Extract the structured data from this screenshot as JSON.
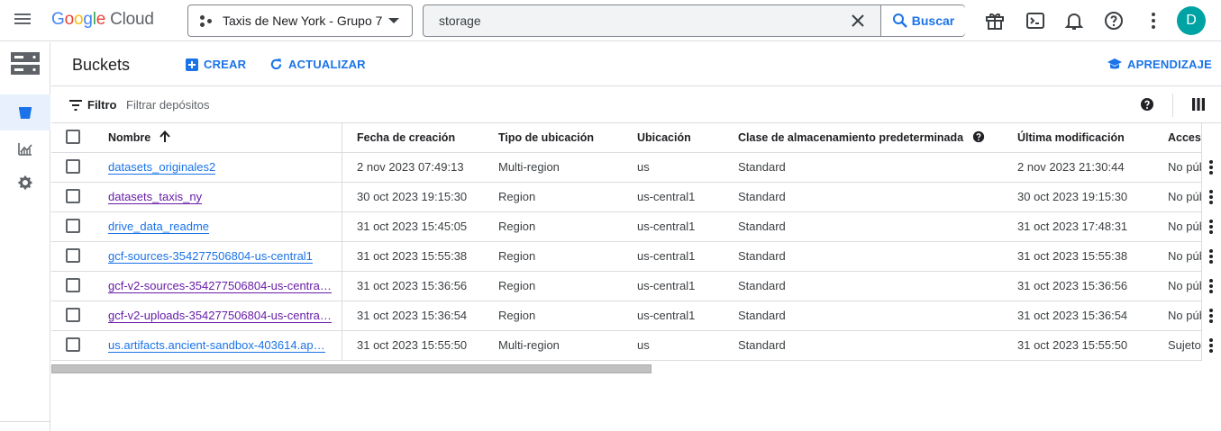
{
  "topbar": {
    "logo": {
      "g": "G",
      "o1": "o",
      "o2": "o",
      "g2": "g",
      "l": "l",
      "e": "e",
      "cloud": "Cloud"
    },
    "project": "Taxis de New York - Grupo 7",
    "search_value": "storage",
    "search_button": "Buscar",
    "avatar_initial": "D"
  },
  "header": {
    "title": "Buckets",
    "create": "CREAR",
    "refresh": "ACTUALIZAR",
    "learn": "APRENDIZAJE"
  },
  "filter": {
    "label": "Filtro",
    "placeholder": "Filtrar depósitos"
  },
  "table": {
    "headers": {
      "name": "Nombre",
      "created": "Fecha de creación",
      "location_type": "Tipo de ubicación",
      "location": "Ubicación",
      "storage_class": "Clase de almacenamiento predeterminada",
      "modified": "Última modificación",
      "access": "Acceso"
    },
    "rows": [
      {
        "name": "datasets_originales2",
        "created": "2 nov 2023 07:49:13",
        "location_type": "Multi-region",
        "location": "us",
        "storage_class": "Standard",
        "modified": "2 nov 2023 21:30:44",
        "access": "No público",
        "visited": false
      },
      {
        "name": "datasets_taxis_ny",
        "created": "30 oct 2023 19:15:30",
        "location_type": "Region",
        "location": "us-central1",
        "storage_class": "Standard",
        "modified": "30 oct 2023 19:15:30",
        "access": "No público",
        "visited": true
      },
      {
        "name": "drive_data_readme",
        "created": "31 oct 2023 15:45:05",
        "location_type": "Region",
        "location": "us-central1",
        "storage_class": "Standard",
        "modified": "31 oct 2023 17:48:31",
        "access": "No público",
        "visited": false
      },
      {
        "name": "gcf-sources-354277506804-us-central1",
        "created": "31 oct 2023 15:55:38",
        "location_type": "Region",
        "location": "us-central1",
        "storage_class": "Standard",
        "modified": "31 oct 2023 15:55:38",
        "access": "No público",
        "visited": false
      },
      {
        "name": "gcf-v2-sources-354277506804-us-centra…",
        "created": "31 oct 2023 15:36:56",
        "location_type": "Region",
        "location": "us-central1",
        "storage_class": "Standard",
        "modified": "31 oct 2023 15:36:56",
        "access": "No público",
        "visited": true
      },
      {
        "name": "gcf-v2-uploads-354277506804-us-centra…",
        "created": "31 oct 2023 15:36:54",
        "location_type": "Region",
        "location": "us-central1",
        "storage_class": "Standard",
        "modified": "31 oct 2023 15:36:54",
        "access": "No público",
        "visited": true
      },
      {
        "name": "us.artifacts.ancient-sandbox-403614.ap…",
        "created": "31 oct 2023 15:55:50",
        "location_type": "Multi-region",
        "location": "us",
        "storage_class": "Standard",
        "modified": "31 oct 2023 15:55:50",
        "access": "Sujeto",
        "visited": false
      }
    ]
  },
  "colors": {
    "accent": "#1a73e8",
    "visited_link": "#681da8",
    "avatar": "#00a3a3",
    "nav_active": "#e8f0fe"
  }
}
